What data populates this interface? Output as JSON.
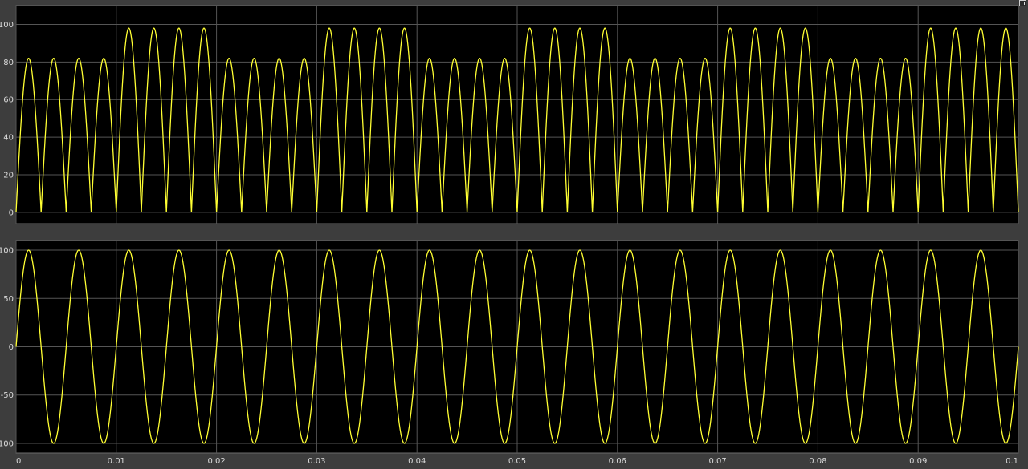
{
  "colors": {
    "background": "#3d3d3d",
    "axes": "#000000",
    "grid": "#555555",
    "trace": "#ffff33",
    "ticks": "#d9d9d9"
  },
  "icons": {
    "undock": "undock-arrow-icon"
  },
  "chart_data": [
    {
      "type": "line",
      "title": "",
      "xlabel": "",
      "ylabel": "",
      "xlim": [
        0,
        0.1
      ],
      "ylim": [
        -6,
        110
      ],
      "x_ticks": [
        0,
        0.01,
        0.02,
        0.03,
        0.04,
        0.05,
        0.06,
        0.07,
        0.08,
        0.09,
        0.1
      ],
      "x_tick_labels": [],
      "y_ticks": [
        0,
        20,
        40,
        60,
        80,
        100
      ],
      "y_tick_labels": [
        "0",
        "20",
        "40",
        "60",
        "80",
        "100"
      ],
      "grid": true,
      "legend": "none",
      "series": [
        {
          "function": "abs_sine",
          "frequency_hz": 200,
          "amplitude_segments": [
            {
              "t_start": 0.0,
              "t_end": 0.01,
              "peak": 82
            },
            {
              "t_start": 0.01,
              "t_end": 0.02,
              "peak": 98
            },
            {
              "t_start": 0.02,
              "t_end": 0.03,
              "peak": 82
            },
            {
              "t_start": 0.03,
              "t_end": 0.04,
              "peak": 98
            },
            {
              "t_start": 0.04,
              "t_end": 0.05,
              "peak": 82
            },
            {
              "t_start": 0.05,
              "t_end": 0.06,
              "peak": 98
            },
            {
              "t_start": 0.06,
              "t_end": 0.07,
              "peak": 82
            },
            {
              "t_start": 0.07,
              "t_end": 0.08,
              "peak": 98
            },
            {
              "t_start": 0.08,
              "t_end": 0.09,
              "peak": 82
            },
            {
              "t_start": 0.09,
              "t_end": 0.1,
              "peak": 98
            }
          ]
        }
      ]
    },
    {
      "type": "line",
      "title": "",
      "xlabel": "",
      "ylabel": "",
      "xlim": [
        0,
        0.1
      ],
      "ylim": [
        -110,
        110
      ],
      "x_ticks": [
        0,
        0.01,
        0.02,
        0.03,
        0.04,
        0.05,
        0.06,
        0.07,
        0.08,
        0.09,
        0.1
      ],
      "x_tick_labels": [
        "0",
        "0.01",
        "0.02",
        "0.03",
        "0.04",
        "0.05",
        "0.06",
        "0.07",
        "0.08",
        "0.09",
        "0.1"
      ],
      "y_ticks": [
        -100,
        -50,
        0,
        50,
        100
      ],
      "y_tick_labels": [
        "-100",
        "-50",
        "0",
        "50",
        "100"
      ],
      "grid": true,
      "legend": "none",
      "series": [
        {
          "function": "sine",
          "frequency_hz": 200,
          "amplitude": 100
        }
      ]
    }
  ]
}
